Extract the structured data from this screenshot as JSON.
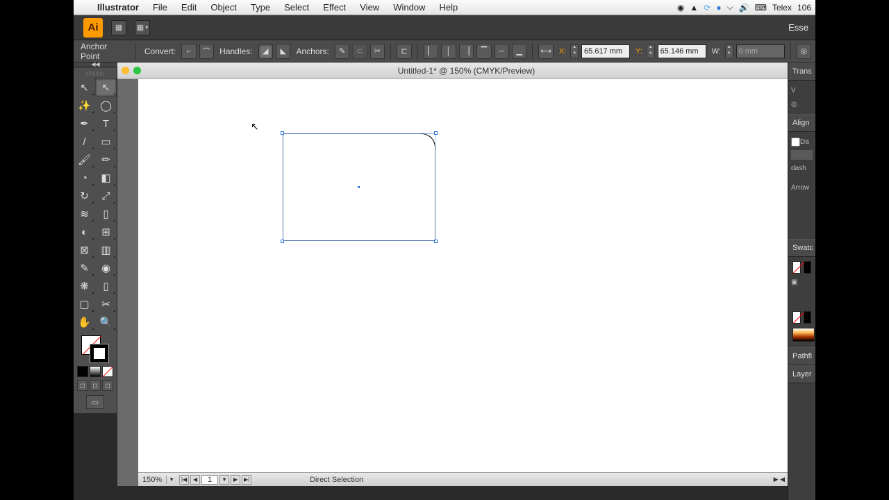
{
  "menubar": {
    "app": "Illustrator",
    "items": [
      "File",
      "Edit",
      "Object",
      "Type",
      "Select",
      "Effect",
      "View",
      "Window",
      "Help"
    ],
    "right": {
      "input": "Telex",
      "pct": "106"
    }
  },
  "appbar": {
    "logo": "Ai",
    "workspace": "Esse"
  },
  "controlbar": {
    "mode": "Anchor Point",
    "convert": "Convert:",
    "handles": "Handles:",
    "anchors": "Anchors:",
    "x_label": "X:",
    "x_value": "65.617 mm",
    "y_label": "Y:",
    "y_value": "65.146 mm",
    "w_label": "W:",
    "w_value": "0 mm"
  },
  "document": {
    "title": "Untitled-1* @ 150% (CMYK/Preview)"
  },
  "panels": {
    "transform": "Trans",
    "align": "Align",
    "dashed": "Da",
    "dash": "dash",
    "arrow": "Arrow",
    "swatches": "Swatc",
    "pathfinder": "Pathfi",
    "layers": "Layer"
  },
  "statusbar": {
    "zoom": "150%",
    "page": "1",
    "tool": "Direct Selection"
  }
}
